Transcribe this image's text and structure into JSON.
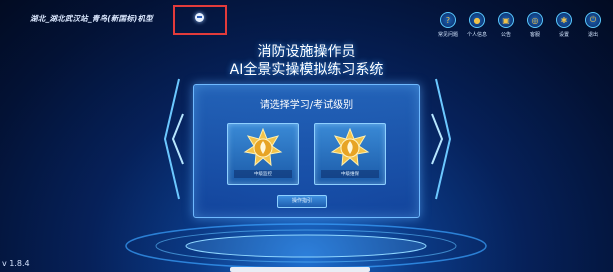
{
  "header": {
    "location": "湖北_湖北武汉站_青鸟(新国标)机型"
  },
  "toolbar": [
    {
      "label": "常见问题",
      "icon": "faq-icon"
    },
    {
      "label": "个人信息",
      "icon": "user-icon"
    },
    {
      "label": "公告",
      "icon": "notice-icon"
    },
    {
      "label": "客服",
      "icon": "service-icon"
    },
    {
      "label": "设置",
      "icon": "settings-icon"
    },
    {
      "label": "退出",
      "icon": "power-icon"
    }
  ],
  "main": {
    "title_line1": "消防设施操作员",
    "title_line2": "AI全景实操模拟练习系统",
    "panel_title": "请选择学习/考试级别",
    "levels": [
      {
        "label": "中级监控"
      },
      {
        "label": "中级维保"
      }
    ],
    "guide_button": "操作指引"
  },
  "version": "v 1.8.4",
  "colors": {
    "highlight_box": "#e23b3b",
    "accent": "#59c9ff",
    "badge_gold": "#f3c34a"
  }
}
